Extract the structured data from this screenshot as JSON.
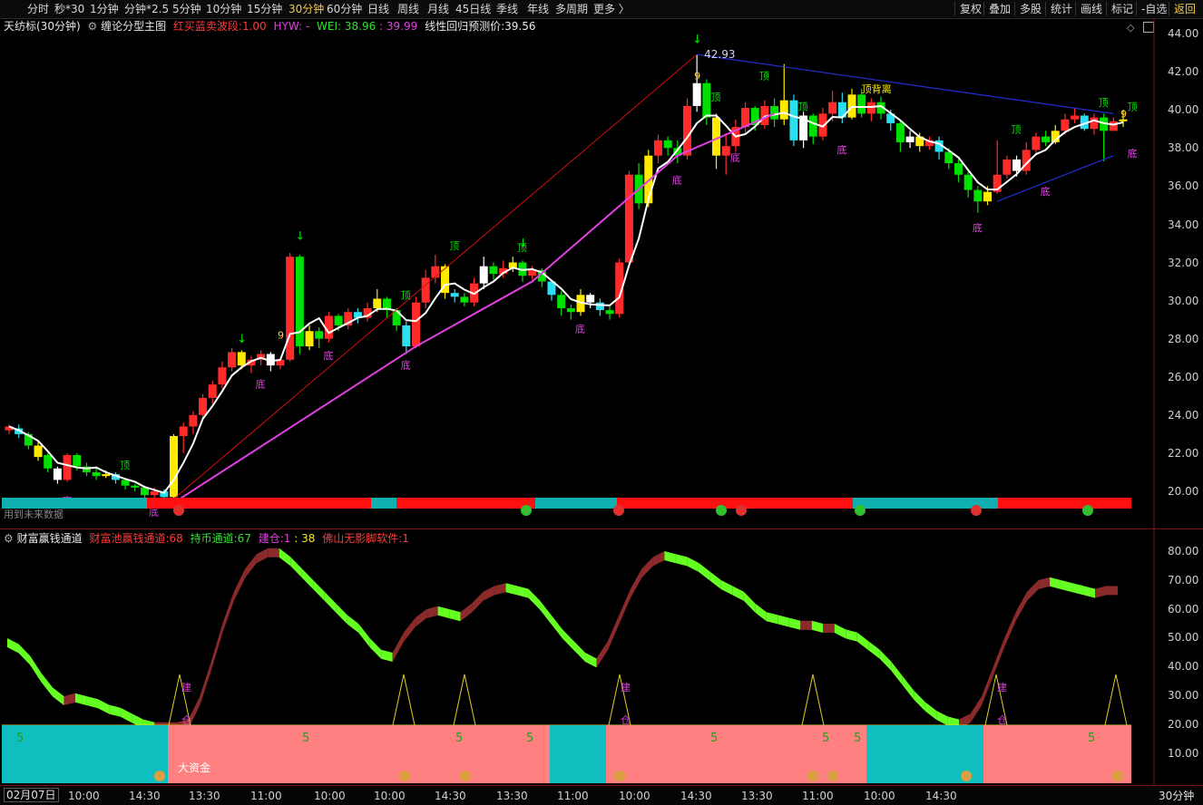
{
  "toolbar": {
    "items": [
      "分时",
      "秒*30",
      "1分钟",
      "分钟*2.5",
      "5分钟",
      "10分钟",
      "15分钟",
      "30分钟",
      "60分钟",
      "日线",
      "周线",
      "月线",
      "45日线",
      "季线",
      "年线",
      "多周期",
      "更多 〉"
    ],
    "active": "30分钟",
    "right_items": [
      "复权",
      "叠加",
      "多股",
      "统计",
      "画线",
      "标记",
      "-自选",
      "返回"
    ]
  },
  "main_info": {
    "title": "天纺标(30分钟)",
    "indicator": "缠论分型主图",
    "swing_label": "红买蓝卖波段:",
    "swing_value": "1.00",
    "hyw": "HYW: -",
    "wei_label": "WEI:",
    "wei_value1": "38.96",
    "wei_value2": "39.99",
    "forecast_label": "线性回归预测价:",
    "forecast_value": "39.56"
  },
  "sub_info": {
    "title": "财富赢钱通道",
    "pool_label": "财富池赢钱通道:",
    "pool_value": "68",
    "hold_label": "持币通道:",
    "hold_value": "67",
    "build_label": "建仓:",
    "build_value1": "1",
    "build_value2": "38",
    "fs_label": "佛山无影脚软件:",
    "fs_value": "1"
  },
  "y_axis_main": [
    "44.00",
    "42.00",
    "40.00",
    "38.00",
    "36.00",
    "34.00",
    "32.00",
    "30.00",
    "28.00",
    "26.00",
    "24.00",
    "22.00",
    "20.00"
  ],
  "y_axis_sub": [
    "80.00",
    "70.00",
    "60.00",
    "50.00",
    "40.00",
    "30.00",
    "20.00",
    "10.00"
  ],
  "x_axis": [
    "10:00",
    "14:30",
    "13:30",
    "11:00",
    "10:00",
    "10:00",
    "14:30",
    "13:30",
    "11:00",
    "10:00",
    "14:30",
    "13:30",
    "11:00",
    "10:00",
    "14:30"
  ],
  "date_label": "02月07日",
  "period_label": "30分钟",
  "price_labels": {
    "high": "42.93",
    "low": "19.39"
  },
  "future_note": "用到未来数据",
  "annotations": {
    "top": "顶",
    "bottom": "底",
    "jian": "建",
    "he": "仓",
    "big_fund": "大资金",
    "nine": "9",
    "top_tag": "顶背离",
    "five": "5"
  },
  "colors": {
    "up": "#ff2b2b",
    "down": "#00e000",
    "yellow": "#ffea00",
    "cyan": "#2ae0f0",
    "white": "#ffffff",
    "magenta": "#e040e0",
    "band_green": "#66ff22",
    "band_red": "#8b2a2a",
    "cyan_block": "#0fbfbf",
    "pink_block": "#ff8080"
  },
  "chart_data": {
    "type": "candlestick",
    "y_range": [
      19,
      44
    ],
    "candles": [
      [
        23.2,
        23.4,
        23.5,
        23.0
      ],
      [
        23.3,
        23.0,
        23.5,
        22.8
      ],
      [
        23.0,
        22.4,
        23.1,
        22.2
      ],
      [
        22.4,
        21.8,
        22.6,
        21.6
      ],
      [
        21.9,
        21.2,
        22.0,
        21.0
      ],
      [
        21.2,
        20.6,
        21.3,
        20.4
      ],
      [
        20.6,
        21.9,
        22.0,
        20.5
      ],
      [
        21.9,
        21.3,
        22.0,
        21.1
      ],
      [
        21.3,
        21.0,
        21.5,
        20.8
      ],
      [
        21.0,
        20.8,
        21.2,
        20.6
      ],
      [
        20.8,
        20.9,
        21.1,
        20.7
      ],
      [
        20.9,
        20.6,
        21.0,
        20.4
      ],
      [
        20.6,
        20.3,
        20.7,
        20.1
      ],
      [
        20.3,
        20.2,
        20.4,
        20.0
      ],
      [
        20.2,
        19.8,
        20.3,
        19.6
      ],
      [
        19.8,
        20.0,
        20.2,
        19.6
      ],
      [
        20.0,
        19.7,
        20.1,
        19.5
      ],
      [
        19.7,
        22.9,
        23.0,
        19.4
      ],
      [
        22.9,
        23.4,
        23.6,
        22.0
      ],
      [
        23.4,
        24.0,
        24.2,
        23.0
      ],
      [
        24.0,
        24.9,
        25.1,
        23.8
      ],
      [
        24.9,
        25.6,
        25.8,
        24.6
      ],
      [
        25.6,
        26.5,
        26.8,
        25.4
      ],
      [
        26.5,
        27.3,
        27.5,
        26.3
      ],
      [
        27.3,
        26.6,
        27.4,
        26.4
      ],
      [
        26.6,
        26.9,
        27.1,
        26.2
      ],
      [
        26.9,
        27.2,
        27.4,
        26.6
      ],
      [
        27.2,
        26.6,
        27.3,
        26.3
      ],
      [
        26.6,
        26.9,
        27.0,
        26.4
      ],
      [
        26.9,
        32.3,
        32.5,
        26.8
      ],
      [
        32.3,
        27.6,
        32.4,
        27.2
      ],
      [
        27.6,
        28.4,
        28.7,
        27.4
      ],
      [
        28.4,
        28.0,
        28.6,
        27.5
      ],
      [
        28.0,
        29.2,
        29.4,
        27.8
      ],
      [
        29.2,
        28.7,
        29.3,
        28.4
      ],
      [
        28.7,
        29.4,
        29.6,
        28.5
      ],
      [
        29.4,
        29.1,
        29.6,
        28.8
      ],
      [
        29.1,
        29.6,
        29.9,
        28.9
      ],
      [
        29.6,
        30.1,
        30.6,
        29.4
      ],
      [
        30.1,
        29.5,
        30.2,
        29.1
      ],
      [
        29.5,
        28.7,
        29.6,
        28.4
      ],
      [
        28.7,
        27.6,
        28.9,
        27.2
      ],
      [
        27.6,
        29.9,
        30.2,
        27.5
      ],
      [
        29.9,
        31.2,
        31.6,
        29.6
      ],
      [
        31.2,
        31.8,
        32.4,
        30.9
      ],
      [
        31.8,
        30.4,
        31.9,
        30.1
      ],
      [
        30.4,
        30.2,
        30.6,
        29.9
      ],
      [
        30.2,
        29.9,
        30.4,
        29.7
      ],
      [
        29.9,
        30.9,
        31.2,
        29.7
      ],
      [
        30.9,
        31.8,
        32.3,
        30.6
      ],
      [
        31.8,
        31.4,
        32.0,
        31.1
      ],
      [
        31.4,
        31.7,
        32.1,
        31.2
      ],
      [
        31.7,
        32.0,
        32.3,
        31.5
      ],
      [
        32.0,
        31.3,
        32.1,
        31.0
      ],
      [
        31.3,
        31.6,
        31.8,
        31.1
      ],
      [
        31.6,
        31.0,
        31.7,
        30.7
      ],
      [
        31.0,
        30.3,
        31.1,
        30.0
      ],
      [
        30.3,
        29.6,
        30.5,
        29.2
      ],
      [
        29.6,
        29.4,
        29.8,
        29.0
      ],
      [
        29.4,
        30.3,
        30.6,
        29.2
      ],
      [
        30.3,
        29.9,
        30.4,
        29.6
      ],
      [
        29.9,
        29.5,
        30.1,
        29.2
      ],
      [
        29.5,
        29.3,
        29.7,
        29.0
      ],
      [
        29.3,
        32.0,
        32.2,
        29.1
      ],
      [
        32.0,
        36.6,
        36.8,
        31.8
      ],
      [
        36.6,
        35.1,
        37.2,
        34.8
      ],
      [
        35.1,
        37.6,
        37.9,
        34.9
      ],
      [
        37.6,
        38.4,
        38.7,
        37.2
      ],
      [
        38.4,
        38.0,
        38.6,
        37.6
      ],
      [
        38.0,
        37.6,
        38.4,
        37.2
      ],
      [
        37.6,
        40.2,
        40.6,
        37.4
      ],
      [
        40.2,
        41.4,
        42.9,
        39.9
      ],
      [
        41.4,
        39.6,
        41.6,
        39.2
      ],
      [
        39.6,
        37.6,
        39.8,
        36.9
      ],
      [
        37.6,
        38.1,
        38.8,
        36.6
      ],
      [
        38.1,
        39.1,
        39.5,
        37.8
      ],
      [
        39.1,
        40.1,
        40.4,
        38.8
      ],
      [
        40.1,
        39.2,
        40.2,
        38.9
      ],
      [
        39.2,
        40.2,
        40.5,
        39.0
      ],
      [
        40.2,
        39.5,
        40.6,
        39.1
      ],
      [
        39.5,
        40.5,
        42.4,
        39.2
      ],
      [
        40.5,
        38.4,
        40.8,
        38.1
      ],
      [
        38.4,
        39.7,
        39.9,
        38.0
      ],
      [
        39.7,
        38.6,
        39.8,
        38.2
      ],
      [
        38.6,
        39.8,
        40.1,
        38.4
      ],
      [
        39.8,
        40.4,
        41.0,
        39.4
      ],
      [
        40.4,
        39.6,
        40.9,
        39.3
      ],
      [
        39.6,
        40.8,
        41.1,
        39.5
      ],
      [
        40.8,
        39.8,
        41.1,
        39.6
      ],
      [
        39.8,
        40.4,
        40.6,
        39.4
      ],
      [
        40.4,
        39.8,
        40.7,
        39.5
      ],
      [
        39.8,
        39.3,
        40.0,
        38.9
      ],
      [
        39.3,
        38.3,
        39.5,
        37.8
      ],
      [
        38.3,
        38.6,
        38.9,
        38.0
      ],
      [
        38.6,
        38.1,
        38.8,
        37.8
      ],
      [
        38.1,
        38.4,
        38.6,
        37.9
      ],
      [
        38.4,
        37.8,
        38.6,
        37.4
      ],
      [
        37.8,
        37.2,
        38.0,
        36.9
      ],
      [
        37.2,
        36.6,
        37.4,
        36.2
      ],
      [
        36.6,
        35.8,
        36.8,
        35.4
      ],
      [
        35.8,
        35.2,
        36.0,
        34.6
      ],
      [
        35.2,
        35.7,
        36.0,
        35.0
      ],
      [
        35.7,
        36.6,
        38.4,
        35.6
      ],
      [
        36.6,
        37.4,
        37.6,
        36.4
      ],
      [
        37.4,
        36.8,
        37.6,
        36.5
      ],
      [
        36.8,
        37.9,
        38.3,
        36.6
      ],
      [
        37.9,
        38.6,
        38.8,
        37.6
      ],
      [
        38.6,
        38.3,
        38.9,
        38.1
      ],
      [
        38.3,
        38.9,
        39.2,
        38.2
      ],
      [
        38.9,
        39.5,
        39.8,
        38.7
      ],
      [
        39.5,
        39.7,
        40.1,
        39.3
      ],
      [
        39.7,
        39.0,
        39.8,
        38.9
      ],
      [
        39.0,
        39.6,
        39.8,
        38.7
      ],
      [
        39.6,
        38.9,
        39.8,
        37.3
      ],
      [
        38.9,
        39.4,
        39.6,
        38.9
      ],
      [
        39.4,
        39.5,
        40.0,
        39.1
      ]
    ],
    "sub_channel_upper": [
      50,
      48,
      44,
      38,
      33,
      30,
      31,
      30,
      29,
      27,
      26,
      24,
      22,
      21,
      21,
      21,
      22,
      30,
      42,
      55,
      66,
      74,
      79,
      81,
      81,
      78,
      74,
      70,
      66,
      62,
      58,
      55,
      50,
      46,
      45,
      52,
      57,
      60,
      61,
      60,
      59,
      62,
      66,
      68,
      69,
      68,
      67,
      63,
      58,
      53,
      49,
      45,
      43,
      49,
      58,
      67,
      74,
      78,
      80,
      79,
      78,
      76,
      73,
      70,
      68,
      66,
      62,
      59,
      58,
      57,
      56,
      56,
      55,
      55,
      53,
      52,
      49,
      46,
      42,
      37,
      32,
      28,
      25,
      23,
      22,
      24,
      30,
      40,
      50,
      59,
      66,
      70,
      71,
      70,
      69,
      68,
      67,
      68,
      68
    ]
  }
}
